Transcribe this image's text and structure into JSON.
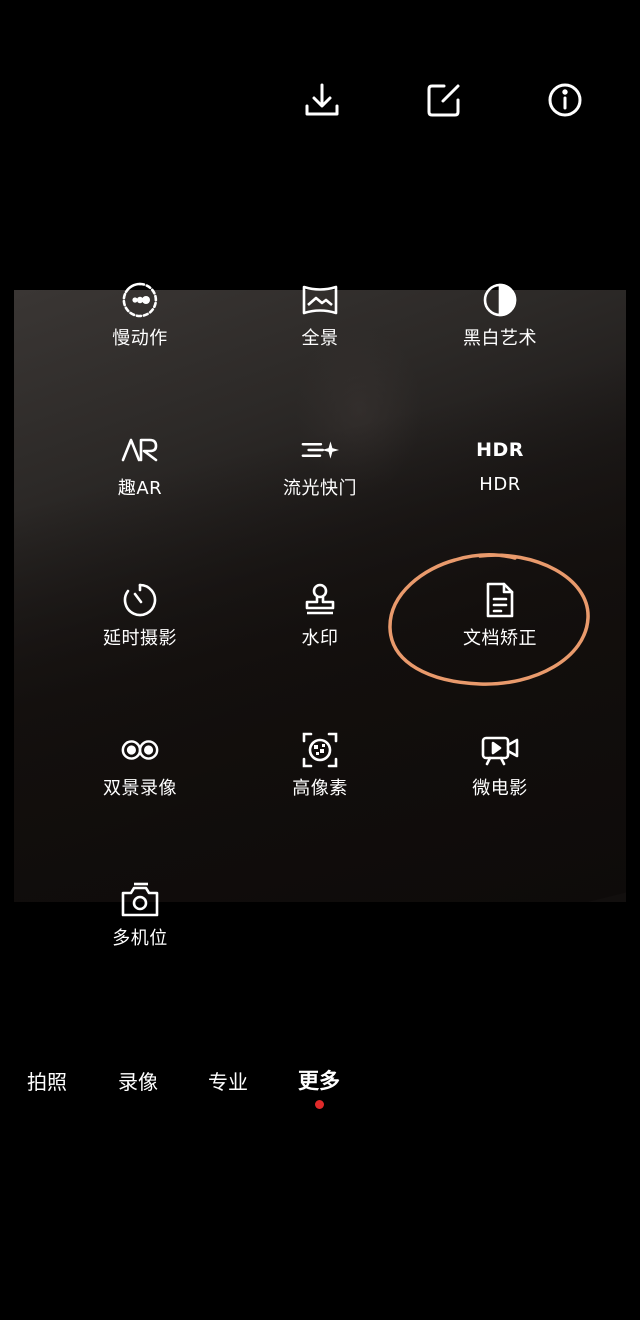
{
  "top_actions": [
    {
      "icon": "download-icon"
    },
    {
      "icon": "edit-icon"
    },
    {
      "icon": "info-icon"
    }
  ],
  "modes": [
    {
      "label": "慢动作",
      "icon": "slow-motion-icon"
    },
    {
      "label": "全景",
      "icon": "panorama-icon"
    },
    {
      "label": "黑白艺术",
      "icon": "monochrome-icon"
    },
    {
      "label": "趣AR",
      "icon": "ar-icon",
      "icon_text": "AR"
    },
    {
      "label": "流光快门",
      "icon": "light-trail-icon"
    },
    {
      "label": "HDR",
      "icon": "hdr-icon",
      "icon_text": "HDR"
    },
    {
      "label": "延时摄影",
      "icon": "timelapse-icon"
    },
    {
      "label": "水印",
      "icon": "watermark-stamp-icon"
    },
    {
      "label": "文档矫正",
      "icon": "document-icon"
    },
    {
      "label": "双景录像",
      "icon": "dual-view-icon"
    },
    {
      "label": "高像素",
      "icon": "high-resolution-icon"
    },
    {
      "label": "微电影",
      "icon": "movie-camera-icon"
    },
    {
      "label": "多机位",
      "icon": "multi-camera-icon"
    }
  ],
  "tabs": [
    {
      "label": "拍照"
    },
    {
      "label": "录像"
    },
    {
      "label": "专业"
    },
    {
      "label": "更多",
      "active": true
    }
  ],
  "colors": {
    "annotation": "#e99a6c",
    "active_dot": "#e02a2a"
  }
}
